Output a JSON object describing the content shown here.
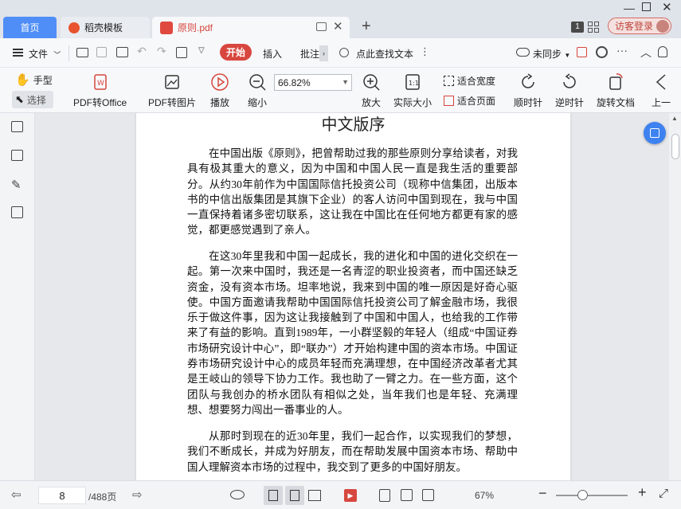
{
  "tabs": {
    "home": "首页",
    "template": "稻壳模板",
    "pdf": "原则.pdf",
    "badge": "1",
    "login": "访客登录"
  },
  "menu": {
    "file": "文件",
    "start": "开始",
    "insert": "插入",
    "annotate": "批注",
    "search": "点此查找文本",
    "sync": "未同步"
  },
  "ribbon": {
    "hand": "手型",
    "select": "选择",
    "pdf_office": "PDF转Office",
    "pdf_image": "PDF转图片",
    "play": "播放",
    "zoom_out": "缩小",
    "zoom_value": "66.82%",
    "zoom_in": "放大",
    "actual_size": "实际大小",
    "fit_width": "适合宽度",
    "fit_page": "适合页面",
    "rotate_cw": "顺时针",
    "rotate_ccw": "逆时针",
    "rotate_doc": "旋转文档",
    "prev": "上一"
  },
  "document": {
    "title": "中文版序",
    "paragraphs": [
      "在中国出版《原则》，把曾帮助过我的那些原则分享给读者，对我具有极其重大的意义，因为中国和中国人民一直是我生活的重要部分。从约30年前作为中国国际信托投资公司（现称中信集团，出版本书的中信出版集团是其旗下企业）的客人访问中国到现在，我与中国一直保持着诸多密切联系，这让我在中国比在任何地方都更有家的感觉，都更感觉遇到了亲人。",
      "在这30年里我和中国一起成长，我的进化和中国的进化交织在一起。第一次来中国时，我还是一名青涩的职业投资者，而中国还缺乏资金，没有资本市场。坦率地说，我来到中国的唯一原因是好奇心驱使。中国方面邀请我帮助中国国际信托投资公司了解金融市场，我很乐于做这件事，因为这让我接触到了中国和中国人，也给我的工作带来了有益的影响。直到1989年，一小群坚毅的年轻人（组成“中国证券市场研究设计中心”，即“联办”）才开始构建中国的资本市场。中国证券市场研究设计中心的成员年轻而充满理想，在中国经济改革者尤其是王岐山的领导下协力工作。我也助了一臂之力。在一些方面，这个团队与我创办的桥水团队有相似之处，当年我们也是年轻、充满理想、想要努力闯出一番事业的人。",
      "从那时到现在的近30年里，我们一起合作，以实现我们的梦想，我们不断成长，并成为好朋友，而在帮助发展中国资本市场、帮助中国人理解资本市场的过程中，我交到了更多的中国好朋友。"
    ]
  },
  "status": {
    "page": "8",
    "total": "/488页",
    "zoom": "67%"
  },
  "colors": {
    "accent": "#d8473f",
    "blue": "#4f8ef7"
  }
}
